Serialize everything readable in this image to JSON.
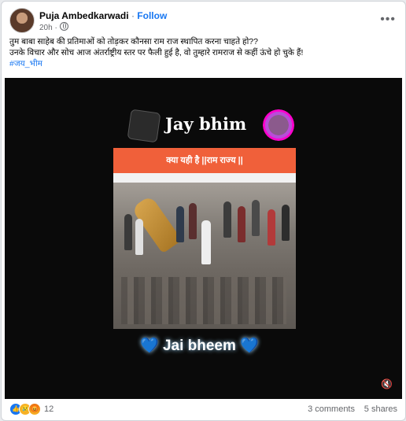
{
  "post": {
    "author": "Puja Ambedkarwadi",
    "separator": "·",
    "follow_label": "Follow",
    "time": "20h ·",
    "more_label": "•••",
    "text_line1": "तुम बाबा साहेब की प्रतिमाओं को तोड़कर कौनसा राम राज स्थापित करना चाहते हो??",
    "text_line2": "उनके विचार और सोच आज अंतर्राष्ट्रीय स्तर पर फैली हुई है, वो तुम्हारे रामराज से कहीं ऊंचे हो चुके हैं!",
    "hashtag": "#जय_भीम"
  },
  "video": {
    "top_caption": "Jay bhim",
    "banner_text": "क्या यही है ||राम राज्य ||",
    "bottom_caption": "Jai bheem",
    "heart_glyph": "💙",
    "volume_icon": "🔇"
  },
  "footer": {
    "reaction_count": "12",
    "comments": "3 comments",
    "shares": "5 shares"
  },
  "colors": {
    "accent": "#1877f2",
    "banner": "#f0603a"
  }
}
